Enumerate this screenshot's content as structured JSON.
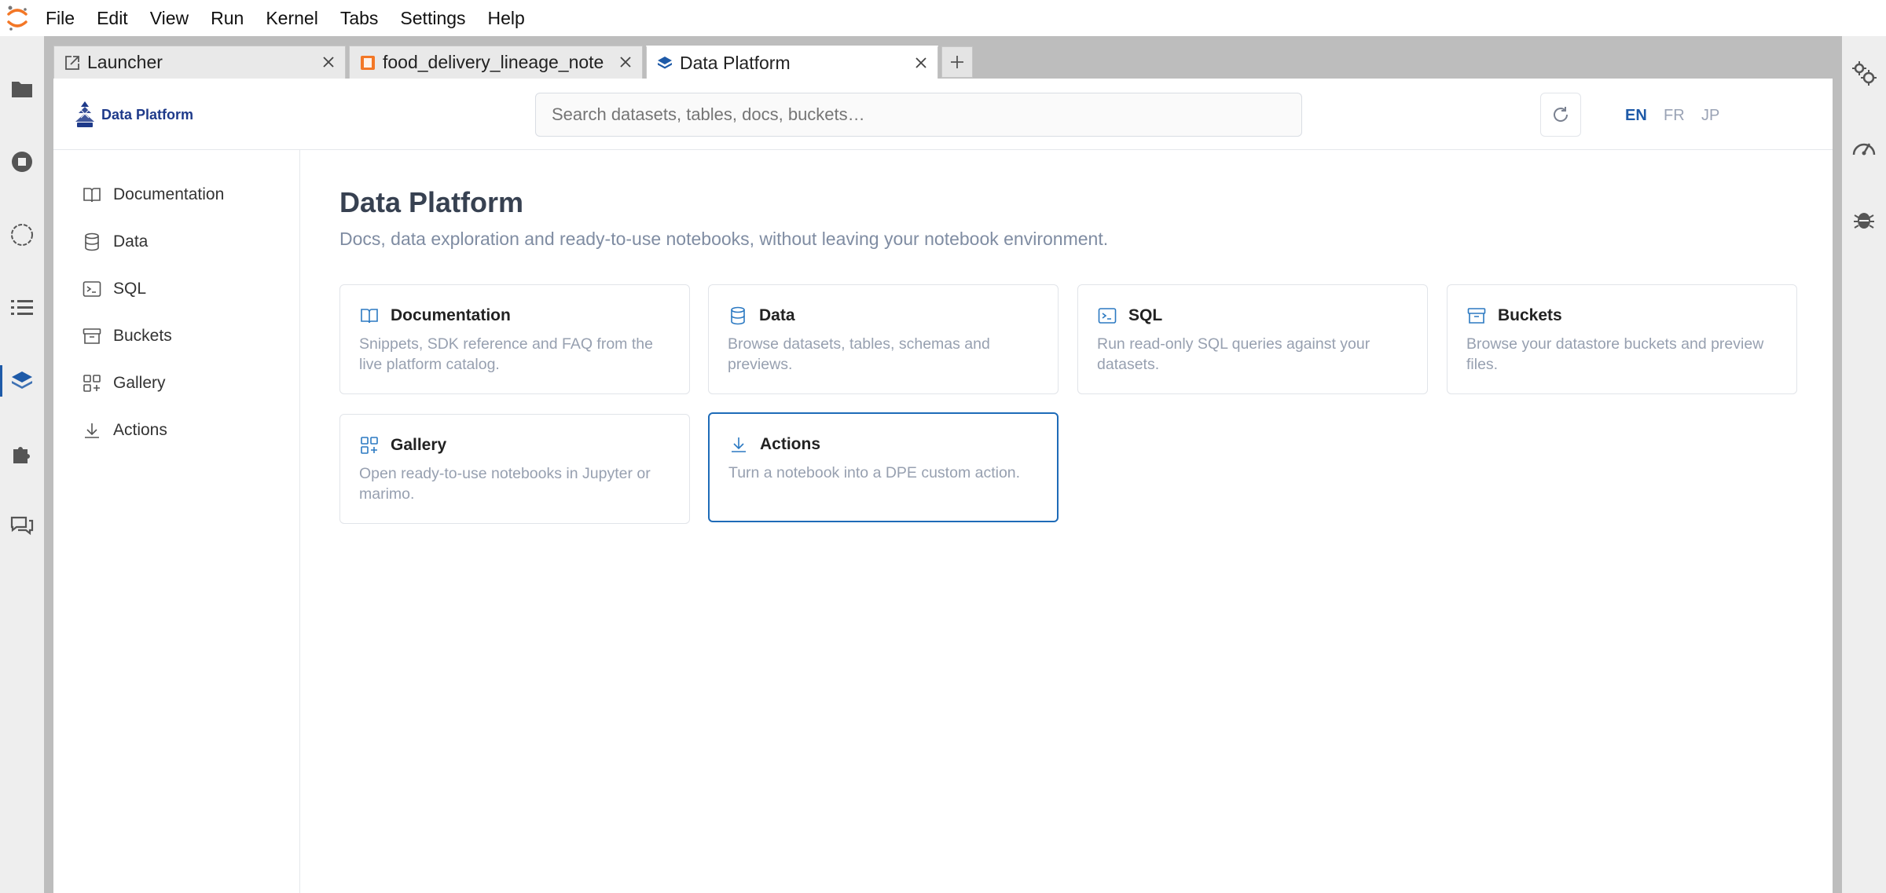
{
  "menubar": {
    "items": [
      "File",
      "Edit",
      "View",
      "Run",
      "Kernel",
      "Tabs",
      "Settings",
      "Help"
    ]
  },
  "tabs": [
    {
      "label": "Launcher",
      "icon": "launcher-icon"
    },
    {
      "label": "food_delivery_lineage_note",
      "icon": "notebook-icon"
    },
    {
      "label": "Data Platform",
      "icon": "data-platform-icon",
      "active": true
    }
  ],
  "header": {
    "brand": "Data Platform",
    "search_placeholder": "Search datasets, tables, docs, buckets…",
    "languages": [
      "EN",
      "FR",
      "JP"
    ],
    "active_language": "EN"
  },
  "sidebar": {
    "items": [
      {
        "label": "Documentation",
        "icon": "book-icon"
      },
      {
        "label": "Data",
        "icon": "database-icon"
      },
      {
        "label": "SQL",
        "icon": "terminal-icon"
      },
      {
        "label": "Buckets",
        "icon": "archive-icon"
      },
      {
        "label": "Gallery",
        "icon": "gallery-icon"
      },
      {
        "label": "Actions",
        "icon": "download-icon"
      }
    ]
  },
  "main": {
    "title": "Data Platform",
    "subtitle": "Docs, data exploration and ready-to-use notebooks, without leaving your notebook environment.",
    "cards": [
      {
        "title": "Documentation",
        "desc": "Snippets, SDK reference and FAQ from the live platform catalog.",
        "icon": "book-icon"
      },
      {
        "title": "Data",
        "desc": "Browse datasets, tables, schemas and previews.",
        "icon": "database-icon"
      },
      {
        "title": "SQL",
        "desc": "Run read-only SQL queries against your datasets.",
        "icon": "terminal-icon"
      },
      {
        "title": "Buckets",
        "desc": "Browse your datastore buckets and preview files.",
        "icon": "archive-icon"
      },
      {
        "title": "Gallery",
        "desc": "Open ready-to-use notebooks in Jupyter or marimo.",
        "icon": "gallery-icon"
      },
      {
        "title": "Actions",
        "desc": "Turn a notebook into a DPE custom action.",
        "icon": "download-icon",
        "selected": true
      }
    ]
  },
  "colors": {
    "accent": "#1e5aa8",
    "brand_text": "#1e3a8a",
    "muted_text": "#97a0b0",
    "card_border_selected": "#1e6bb8"
  }
}
